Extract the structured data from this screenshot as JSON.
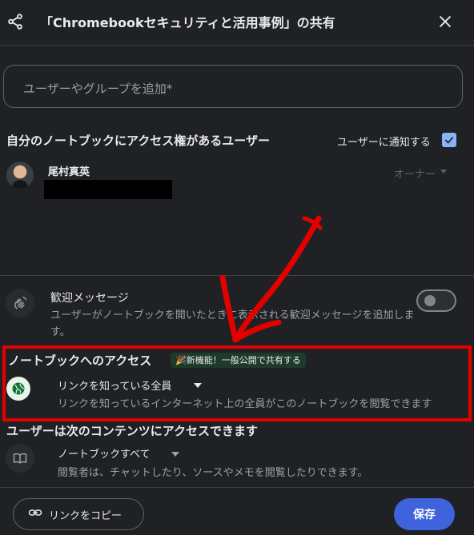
{
  "dialog": {
    "title": "「Chromebookセキュリティと活用事例」の共有",
    "add_input_placeholder": "ユーザーやグループを追加*"
  },
  "access_list": {
    "header": "自分のノートブックにアクセス権があるユーザー",
    "notify_label": "ユーザーに通知する",
    "notify_checked": true,
    "users": [
      {
        "name": "尾村真英",
        "role": "オーナー"
      }
    ]
  },
  "welcome": {
    "title": "歓迎メッセージ",
    "description": "ユーザーがノートブックを開いたときに表示される歓迎メッセージを追加します。",
    "enabled": false
  },
  "notebook_access": {
    "title": "ノートブックへのアクセス",
    "badge": "🎉新機能！一般公開で共有する",
    "scope": "リンクを知っている全員",
    "description": "リンクを知っているインターネット上の全員がこのノートブックを閲覧できます"
  },
  "content_access": {
    "title": "ユーザーは次のコンテンツにアクセスできます",
    "scope": "ノートブックすべて",
    "description": "閲覧者は、チャットしたり、ソースやメモを閲覧したりできます。"
  },
  "footer": {
    "copy_link_label": "リンクをコピー",
    "save_label": "保存"
  },
  "colors": {
    "background": "#202124",
    "accent_blue": "#3e63dd",
    "annotation_red": "#e50000"
  },
  "icons": [
    "share-icon",
    "close-icon",
    "waving-hand-icon",
    "globe-icon",
    "book-icon",
    "link-icon",
    "check-icon"
  ]
}
